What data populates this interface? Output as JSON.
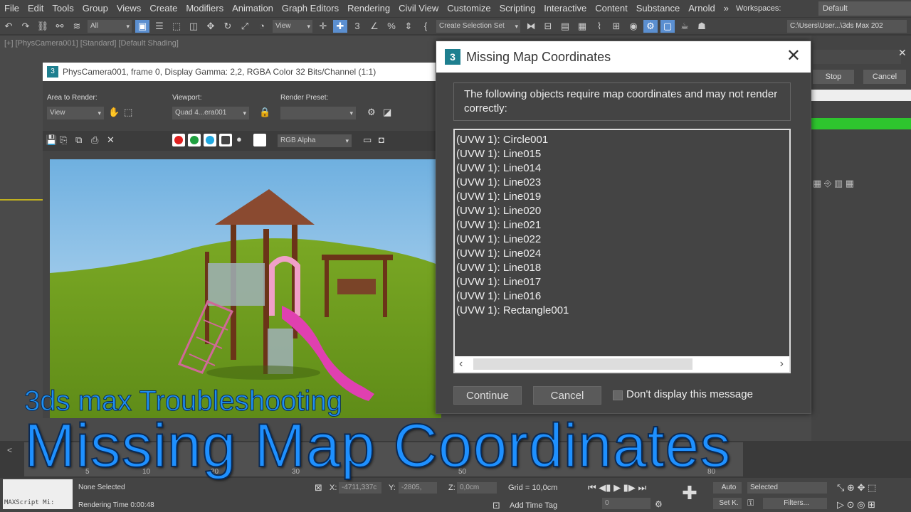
{
  "menubar": {
    "items": [
      "File",
      "Edit",
      "Tools",
      "Group",
      "Views",
      "Create",
      "Modifiers",
      "Animation",
      "Graph Editors",
      "Rendering",
      "Civil View",
      "Customize",
      "Scripting",
      "Interactive",
      "Content",
      "Substance",
      "Arnold"
    ],
    "workspaces_label": "Workspaces:",
    "workspace_value": "Default",
    "overflow": "»"
  },
  "toolbar": {
    "selection_filter": "All",
    "reference_coord": "View",
    "selection_set": "Create Selection Set",
    "path": "C:\\Users\\User...\\3ds Max 202"
  },
  "viewport": {
    "label": "[+] [PhysCamera001] [Standard] [Default Shading]"
  },
  "right_panel": {
    "stop_label": "Stop",
    "cancel_label": "Cancel"
  },
  "frame_buffer": {
    "title": "PhysCamera001, frame 0, Display Gamma: 2,2, RGBA Color 32 Bits/Channel (1:1)",
    "area_label": "Area to Render:",
    "area_value": "View",
    "viewport_label": "Viewport:",
    "viewport_value": "Quad 4...era001",
    "preset_label": "Render Preset:",
    "preset_value": "",
    "channel_value": "RGB Alpha"
  },
  "dialog": {
    "title": "Missing Map Coordinates",
    "message": "The following objects require map coordinates and may not render correctly:",
    "items": [
      "(UVW 1): Circle001",
      "(UVW 1): Line015",
      "(UVW 1): Line014",
      "(UVW 1): Line023",
      "(UVW 1): Line019",
      "(UVW 1): Line020",
      "(UVW 1): Line021",
      "(UVW 1): Line022",
      "(UVW 1): Line024",
      "(UVW 1): Line018",
      "(UVW 1): Line017",
      "(UVW 1): Line016",
      "(UVW 1): Rectangle001"
    ],
    "continue_label": "Continue",
    "cancel_label": "Cancel",
    "checkbox_label": "Don't display this message"
  },
  "timeline": {
    "ticks": [
      "5",
      "10",
      "20",
      "30",
      "50",
      "80"
    ]
  },
  "status": {
    "maxscript": "MAXScript Mi:",
    "selection": "None Selected",
    "rendering_time": "Rendering Time  0:00:48",
    "x_label": "X:",
    "x_value": "-4711,337c",
    "y_label": "Y:",
    "y_value": "-2805,",
    "z_label": "Z:",
    "z_value": "0,0cm",
    "grid": "Grid = 10,0cm",
    "add_time_tag": "Add Time Tag",
    "auto_label": "Auto",
    "selected_value": "Selected",
    "setk_label": "Set K.",
    "filters_label": "Filters...",
    "frame_value": "0"
  },
  "overlay": {
    "subtitle": "3ds max Troubleshooting",
    "title": "Missing Map Coordinates"
  },
  "colors": {
    "accent": "#1e90ff",
    "logo": "#1e7f8f",
    "progress_green": "#2ec52e"
  }
}
